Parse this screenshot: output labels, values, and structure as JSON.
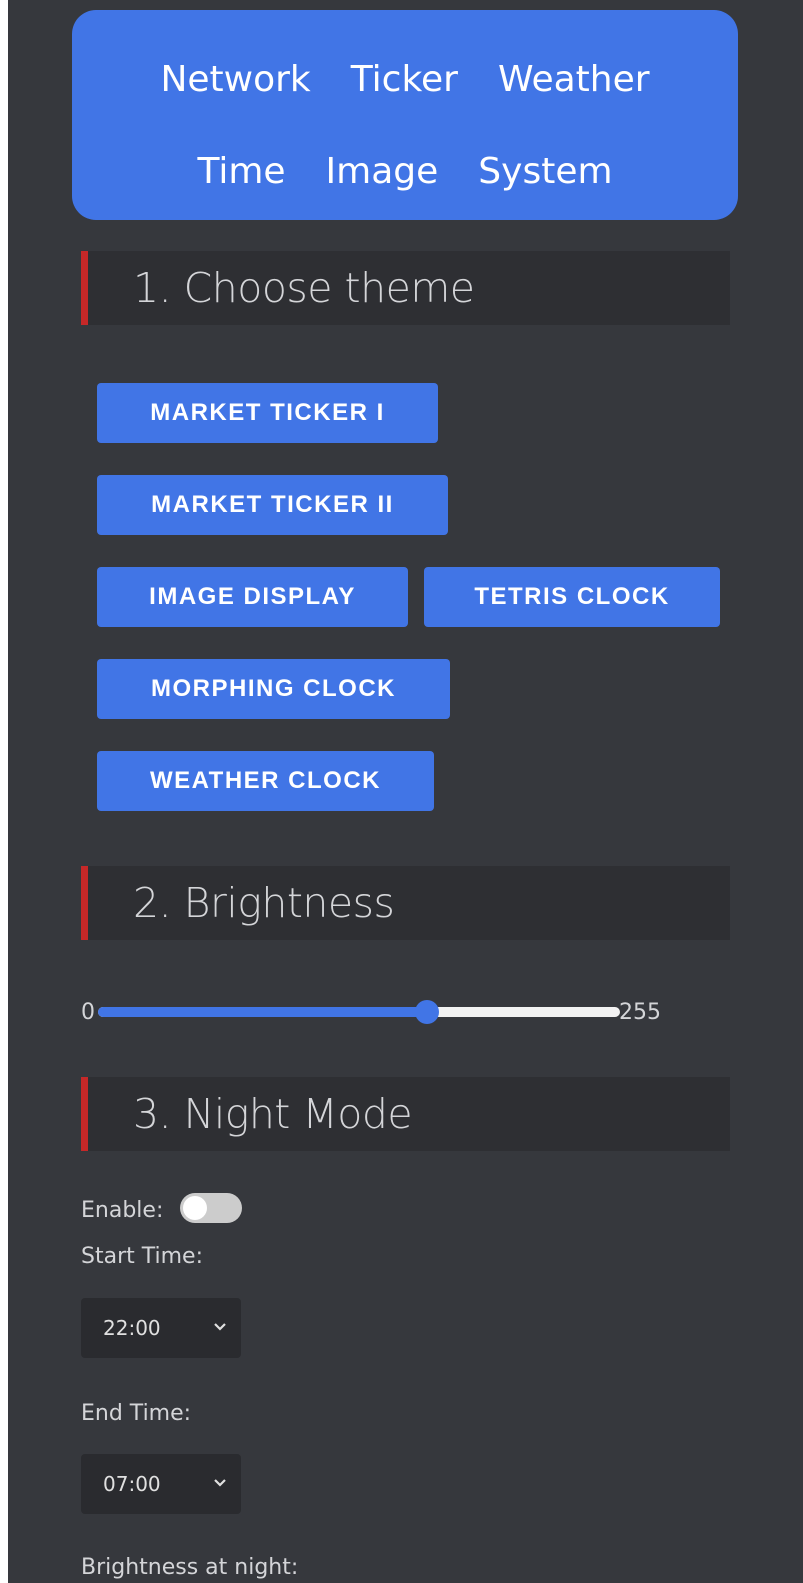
{
  "nav": {
    "row1": [
      "Network",
      "Ticker",
      "Weather"
    ],
    "row2": [
      "Time",
      "Image",
      "System"
    ]
  },
  "sections": {
    "theme": "1. Choose theme",
    "brightness": "2. Brightness",
    "night": "3. Night Mode"
  },
  "themes": {
    "market1": "MARKET TICKER I",
    "market2": "MARKET TICKER II",
    "image": "IMAGE DISPLAY",
    "tetris": "TETRIS CLOCK",
    "morphing": "MORPHING CLOCK",
    "weather": "WEATHER CLOCK"
  },
  "brightness": {
    "min_label": "0",
    "max_label": "255",
    "value_fraction": 0.63
  },
  "night_mode": {
    "enable_label": "Enable:",
    "enabled": false,
    "start_label": "Start Time:",
    "start_value": "22:00",
    "end_label": "End Time:",
    "end_value": "07:00",
    "brightness_label": "Brightness at night:"
  },
  "colors": {
    "accent": "#4175e6",
    "background": "#36383d",
    "section_bar": "#c62828"
  }
}
